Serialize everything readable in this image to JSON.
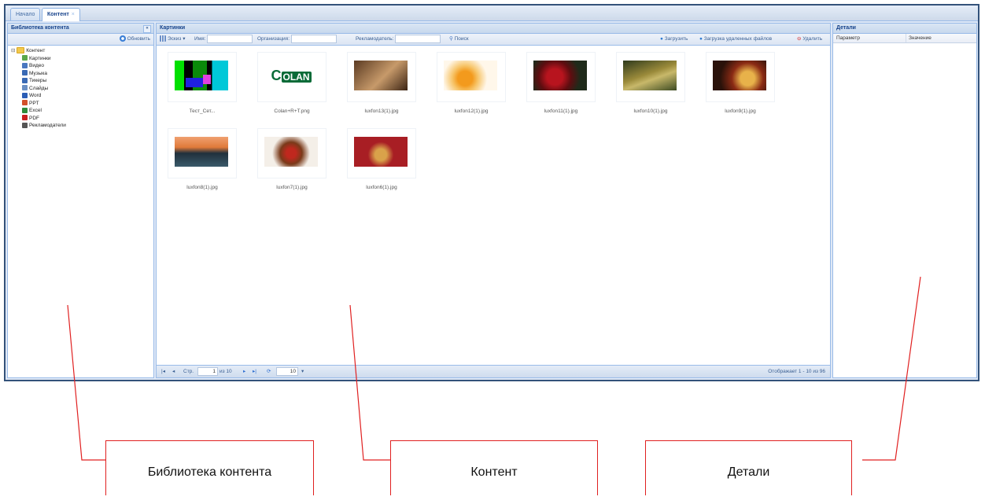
{
  "tabs": [
    {
      "label": "Начало"
    },
    {
      "label": "Контент",
      "close": "×"
    }
  ],
  "left_panel": {
    "title": "Библиотека контента",
    "refresh_label": "Обновить",
    "collapse": "«",
    "tree": {
      "root": "Контент",
      "expander": "⊟",
      "children": [
        {
          "label": "Картинки",
          "icon": "image-icon",
          "color": "#5aa84a"
        },
        {
          "label": "Видео",
          "icon": "video-icon",
          "color": "#4a78c0"
        },
        {
          "label": "Музыка",
          "icon": "music-icon",
          "color": "#3a6ab5"
        },
        {
          "label": "Тикеры",
          "icon": "ticker-icon",
          "color": "#3a6ab5"
        },
        {
          "label": "Слайды",
          "icon": "slides-icon",
          "color": "#6a8fc4"
        },
        {
          "label": "Word",
          "icon": "word-icon",
          "color": "#2b5db5"
        },
        {
          "label": "PPT",
          "icon": "ppt-icon",
          "color": "#d2502a"
        },
        {
          "label": "Excel",
          "icon": "excel-icon",
          "color": "#2e8b3a"
        },
        {
          "label": "PDF",
          "icon": "pdf-icon",
          "color": "#c81e1e"
        },
        {
          "label": "Рекламодатели",
          "icon": "advertisers-icon",
          "color": "#555555"
        }
      ]
    }
  },
  "center_panel": {
    "title": "Картинки",
    "toolbar": {
      "view_label": "Эскиз",
      "view_caret": "▾",
      "name_label": "Имя:",
      "org_label": "Организация:",
      "advertiser_label": "Рекламодатель:",
      "search_label": "Поиск",
      "upload_label": "Загрузить",
      "upload_remote_label": "Загрузка удаленных файлов",
      "delete_label": "Удалить"
    },
    "items": [
      {
        "caption": "Тест_Сет..."
      },
      {
        "caption": "Colan+R+T.png",
        "logo_text": "OLAN",
        "logo_prefix": "C"
      },
      {
        "caption": "luxfon13(1).jpg"
      },
      {
        "caption": "luxfon12(1).jpg"
      },
      {
        "caption": "luxfon11(1).jpg"
      },
      {
        "caption": "luxfon10(1).jpg"
      },
      {
        "caption": "luxfon9(1).jpg"
      },
      {
        "caption": "luxfon8(1).jpg"
      },
      {
        "caption": "luxfon7(1).jpg"
      },
      {
        "caption": "luxfon6(1).jpg"
      }
    ],
    "pager": {
      "first": "|◂",
      "prev": "◂",
      "page_label": "Стр.",
      "page_value": "1",
      "of_label": "из 10",
      "next": "▸",
      "last": "▸|",
      "refresh": "⟳",
      "page_size": "10",
      "page_size_caret": "▾",
      "status": "Отображает 1 - 10 из 96"
    }
  },
  "right_panel": {
    "title": "Детали",
    "col_param": "Параметр",
    "col_value": "Значение"
  },
  "callouts": [
    {
      "label": "Библиотека контента"
    },
    {
      "label": "Контент"
    },
    {
      "label": "Детали"
    }
  ],
  "colors": {
    "frame": "#33527a",
    "header_blue": "#15428b",
    "panel_border": "#99bbe8",
    "callout_red": "#e02020"
  }
}
